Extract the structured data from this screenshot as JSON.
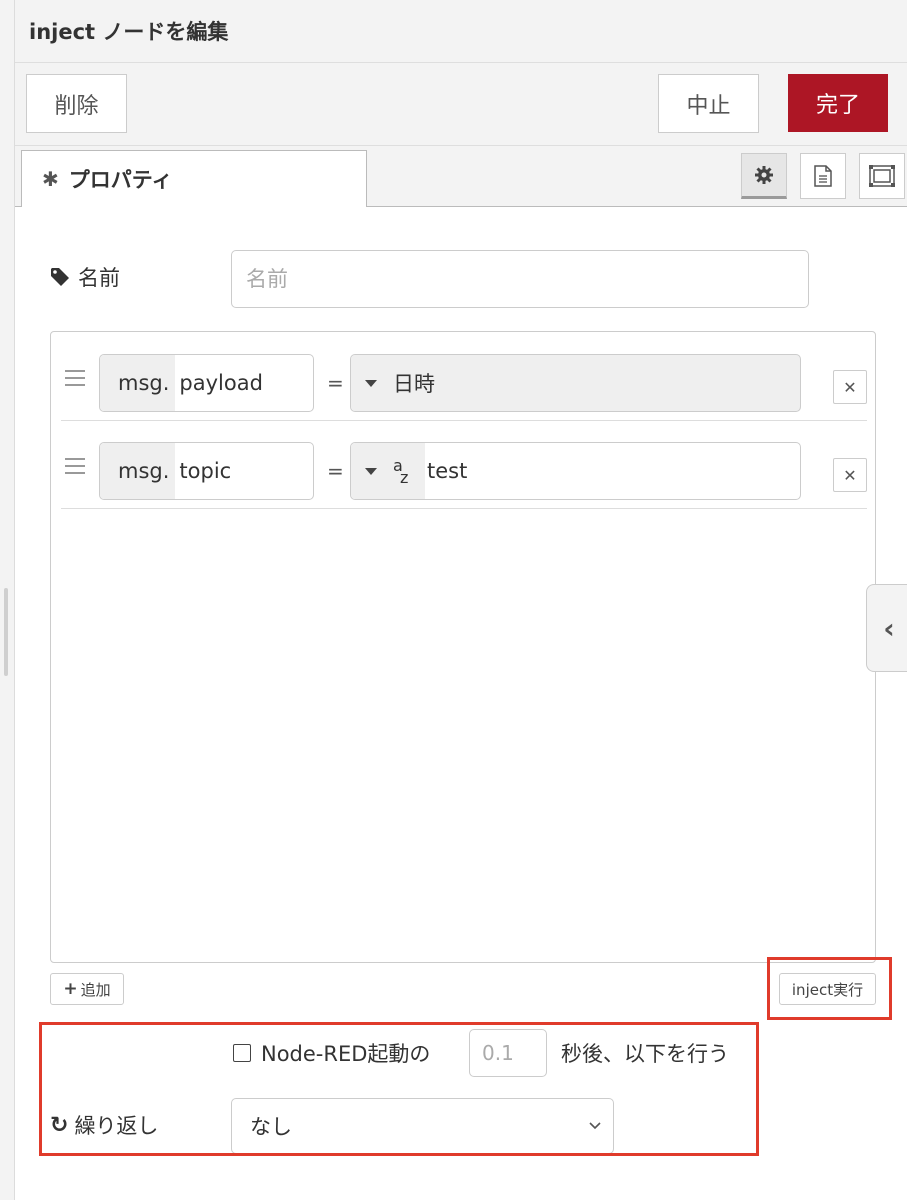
{
  "header": {
    "title": "inject ノードを編集"
  },
  "toolbar": {
    "delete_label": "削除",
    "cancel_label": "中止",
    "done_label": "完了"
  },
  "tabs": {
    "properties_label": "プロパティ"
  },
  "form": {
    "name_label": "名前",
    "name_value": "",
    "name_placeholder": "名前",
    "properties": [
      {
        "prefix": "msg.",
        "key": "payload",
        "equals": "=",
        "type_icon": "caret-down",
        "value": "日時"
      },
      {
        "prefix": "msg.",
        "key": "topic",
        "equals": "=",
        "type_icon": "string-az-icon",
        "type_a": "a",
        "type_z": "z",
        "value": "test"
      }
    ],
    "add_label": "追加",
    "inject_label": "inject実行",
    "once": {
      "label": "Node-RED起動の",
      "delay_placeholder": "0.1",
      "after": "秒後、以下を行う",
      "checked": false
    },
    "repeat_label": "繰り返し",
    "repeat_value": "なし"
  },
  "colors": {
    "done_button": "#ad1625",
    "highlight": "#e03b2b",
    "panel_bg": "#f3f3f3"
  }
}
